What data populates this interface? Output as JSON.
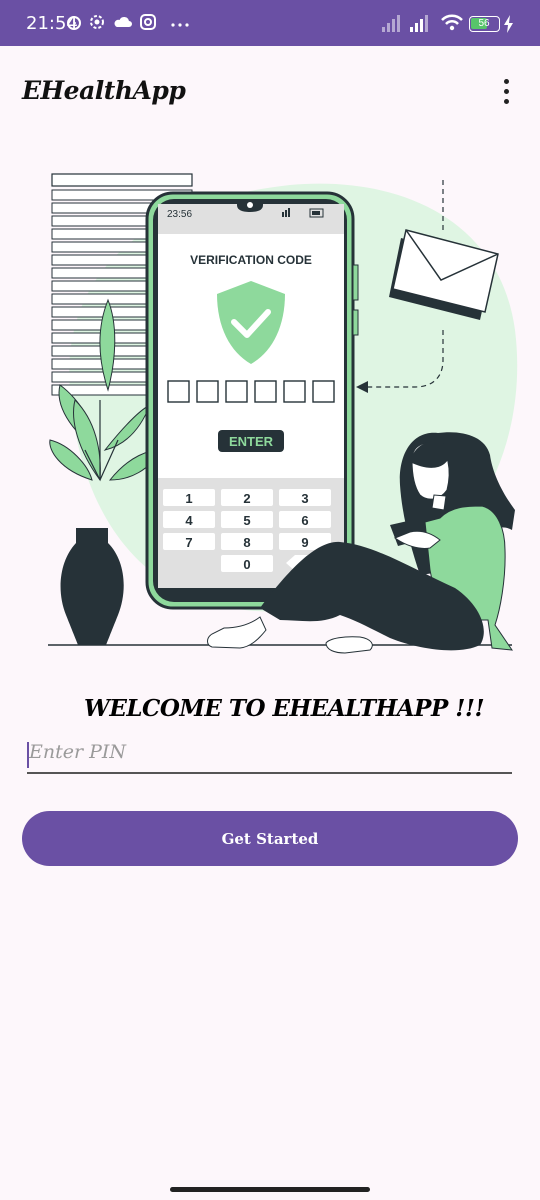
{
  "status_bar": {
    "time": "21:54",
    "battery": "56",
    "icons": [
      "alarm-icon",
      "settings-icon",
      "cloud-icon",
      "instagram-icon",
      "more-dots-icon",
      "signal-icon",
      "signal-icon-2",
      "wifi-icon",
      "battery-icon",
      "charging-icon"
    ]
  },
  "app_bar": {
    "title": "EHealthApp",
    "menu_icon": "more-vert-icon"
  },
  "illustration": {
    "phone_time": "23:56",
    "heading": "VERIFICATION CODE",
    "enter_label": "ENTER",
    "keys": [
      "1",
      "2",
      "3",
      "4",
      "5",
      "6",
      "7",
      "8",
      "9",
      "0"
    ],
    "colors": {
      "accent_green": "#8ed99c",
      "light_green": "#dff5e3",
      "dark": "#263238"
    }
  },
  "welcome_text": "WELCOME TO EHEALTHAPP !!!",
  "pin_input": {
    "placeholder": "Enter PIN",
    "value": ""
  },
  "button": {
    "label": "Get Started"
  },
  "colors": {
    "primary": "#6a50a4",
    "background": "#fdf7fb"
  }
}
